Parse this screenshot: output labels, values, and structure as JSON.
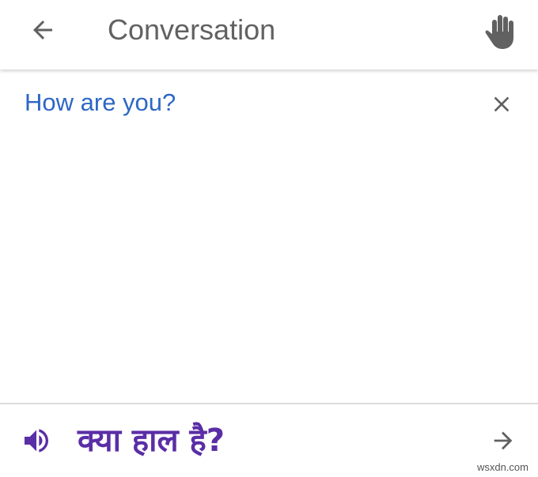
{
  "header": {
    "title": "Conversation",
    "back_icon": "arrow-back-icon",
    "hand_icon": "hand-icon"
  },
  "source": {
    "text": "How are you?",
    "close_icon": "close-icon"
  },
  "translation": {
    "text": "क्या हाल है?",
    "speaker_icon": "speaker-icon",
    "forward_icon": "arrow-forward-icon"
  },
  "watermark": "wsxdn.com",
  "colors": {
    "source_text": "#2d67c5",
    "translation_text": "#5a2ea6",
    "icon_grey": "#616161"
  }
}
